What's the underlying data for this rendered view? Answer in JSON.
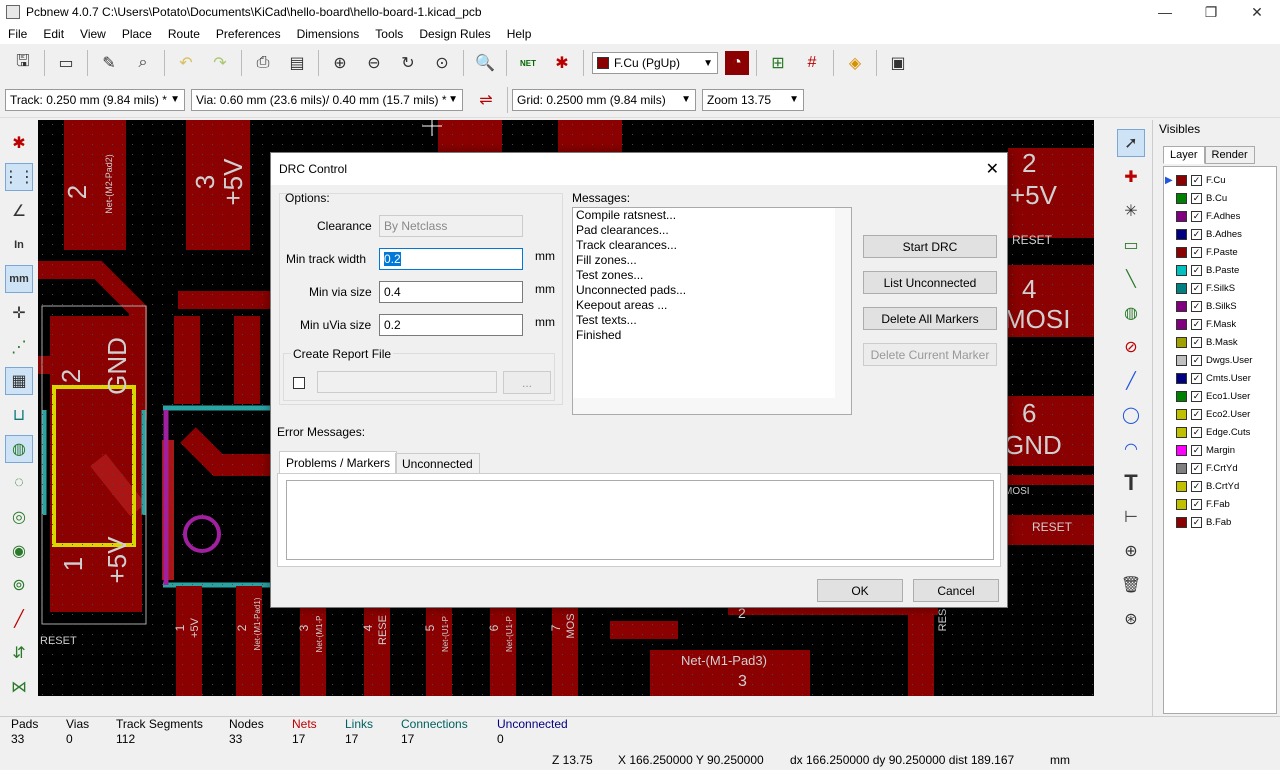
{
  "window": {
    "title": "Pcbnew 4.0.7 C:\\Users\\Potato\\Documents\\KiCad\\hello-board\\hello-board-1.kicad_pcb",
    "min": "—",
    "max": "❐",
    "close": "✕"
  },
  "menu": [
    "File",
    "Edit",
    "View",
    "Place",
    "Route",
    "Preferences",
    "Dimensions",
    "Tools",
    "Design Rules",
    "Help"
  ],
  "toolbar": {
    "layer_select": "F.Cu (PgUp)",
    "track": "Track: 0.250 mm (9.84 mils) *",
    "via": "Via: 0.60 mm (23.6 mils)/ 0.40 mm (15.7 mils) *",
    "grid": "Grid: 0.2500 mm (9.84 mils)",
    "zoom": "Zoom 13.75",
    "net_label": "NET"
  },
  "visibles": {
    "title": "Visibles",
    "tabs": [
      "Layer",
      "Render"
    ],
    "layers": [
      {
        "name": "F.Cu",
        "color": "#8b0000"
      },
      {
        "name": "B.Cu",
        "color": "#008000"
      },
      {
        "name": "F.Adhes",
        "color": "#800080"
      },
      {
        "name": "B.Adhes",
        "color": "#000080"
      },
      {
        "name": "F.Paste",
        "color": "#8b0000"
      },
      {
        "name": "B.Paste",
        "color": "#00c0c0"
      },
      {
        "name": "F.SilkS",
        "color": "#008080"
      },
      {
        "name": "B.SilkS",
        "color": "#800080"
      },
      {
        "name": "F.Mask",
        "color": "#800080"
      },
      {
        "name": "B.Mask",
        "color": "#a0a000"
      },
      {
        "name": "Dwgs.User",
        "color": "#c0c0c0"
      },
      {
        "name": "Cmts.User",
        "color": "#000080"
      },
      {
        "name": "Eco1.User",
        "color": "#008000"
      },
      {
        "name": "Eco2.User",
        "color": "#c0c000"
      },
      {
        "name": "Edge.Cuts",
        "color": "#c0c000"
      },
      {
        "name": "Margin",
        "color": "#ff00ff"
      },
      {
        "name": "F.CrtYd",
        "color": "#808080"
      },
      {
        "name": "B.CrtYd",
        "color": "#c0c000"
      },
      {
        "name": "F.Fab",
        "color": "#c0c000"
      },
      {
        "name": "B.Fab",
        "color": "#8b0000"
      }
    ]
  },
  "status": {
    "pads_label": "Pads",
    "pads": "33",
    "vias_label": "Vias",
    "vias": "0",
    "tracks_label": "Track Segments",
    "tracks": "112",
    "nodes_label": "Nodes",
    "nodes": "33",
    "nets_label": "Nets",
    "nets": "17",
    "links_label": "Links",
    "links": "17",
    "connections_label": "Connections",
    "connections": "17",
    "unconnected_label": "Unconnected",
    "unconnected": "0",
    "zoom": "Z 13.75",
    "xy": "X 166.250000  Y 90.250000",
    "dxy": "dx 166.250000  dy 90.250000  dist 189.167",
    "units": "mm"
  },
  "dialog": {
    "title": "DRC Control",
    "options_label": "Options:",
    "clearance_label": "Clearance",
    "clearance_value": "By Netclass",
    "min_track_label": "Min track width",
    "min_track_value": "0.2",
    "min_via_label": "Min via size",
    "min_via_value": "0.4",
    "min_uvia_label": "Min uVia size",
    "min_uvia_value": "0.2",
    "unit": "mm",
    "report_label": "Create Report File",
    "browse": "...",
    "messages_label": "Messages:",
    "messages": [
      "Compile ratsnest...",
      "Pad clearances...",
      "Track clearances...",
      "Fill zones...",
      "Test zones...",
      "Unconnected pads...",
      "Keepout areas ...",
      "Test texts...",
      "Finished"
    ],
    "start_drc": "Start DRC",
    "list_unconnected": "List Unconnected",
    "delete_all": "Delete All Markers",
    "delete_current": "Delete Current Marker",
    "error_label": "Error Messages:",
    "tab_problems": "Problems / Markers",
    "tab_unconnected": "Unconnected",
    "ok": "OK",
    "cancel": "Cancel"
  },
  "pcb_text": {
    "pad_labels_left": [
      "2",
      "3",
      "+5V",
      "2",
      "GND",
      "1",
      "+5V"
    ],
    "net_m2": "Net-(M2-Pad2)",
    "net_m1_pad3": "Net-(M1-Pad3)",
    "pad3": "3",
    "reset": "RESET",
    "right_2": "2",
    "right_5v": "+5V",
    "right_reset": "RESET",
    "right_4": "4",
    "right_mosi": "MOSI",
    "right_6": "6",
    "right_gnd": "GND",
    "right_mosi2": "MOSI",
    "right_reset2": "RESET",
    "bottom_labels": [
      "1",
      "+5V",
      "2",
      "Net-(M1-Pad1)",
      "3",
      "Net-(M1-P",
      "4",
      "RESE",
      "5",
      "Net-(U1-P",
      "6",
      "Net-(U1-P",
      "7",
      "MOS"
    ],
    "center_2": "2",
    "res": "RES"
  },
  "colors": {
    "pad": "#8b0000",
    "track": "#b31b1b",
    "silk_yellow": "#d8d800",
    "teal": "#2aa3a3",
    "magenta": "#a020a0"
  }
}
